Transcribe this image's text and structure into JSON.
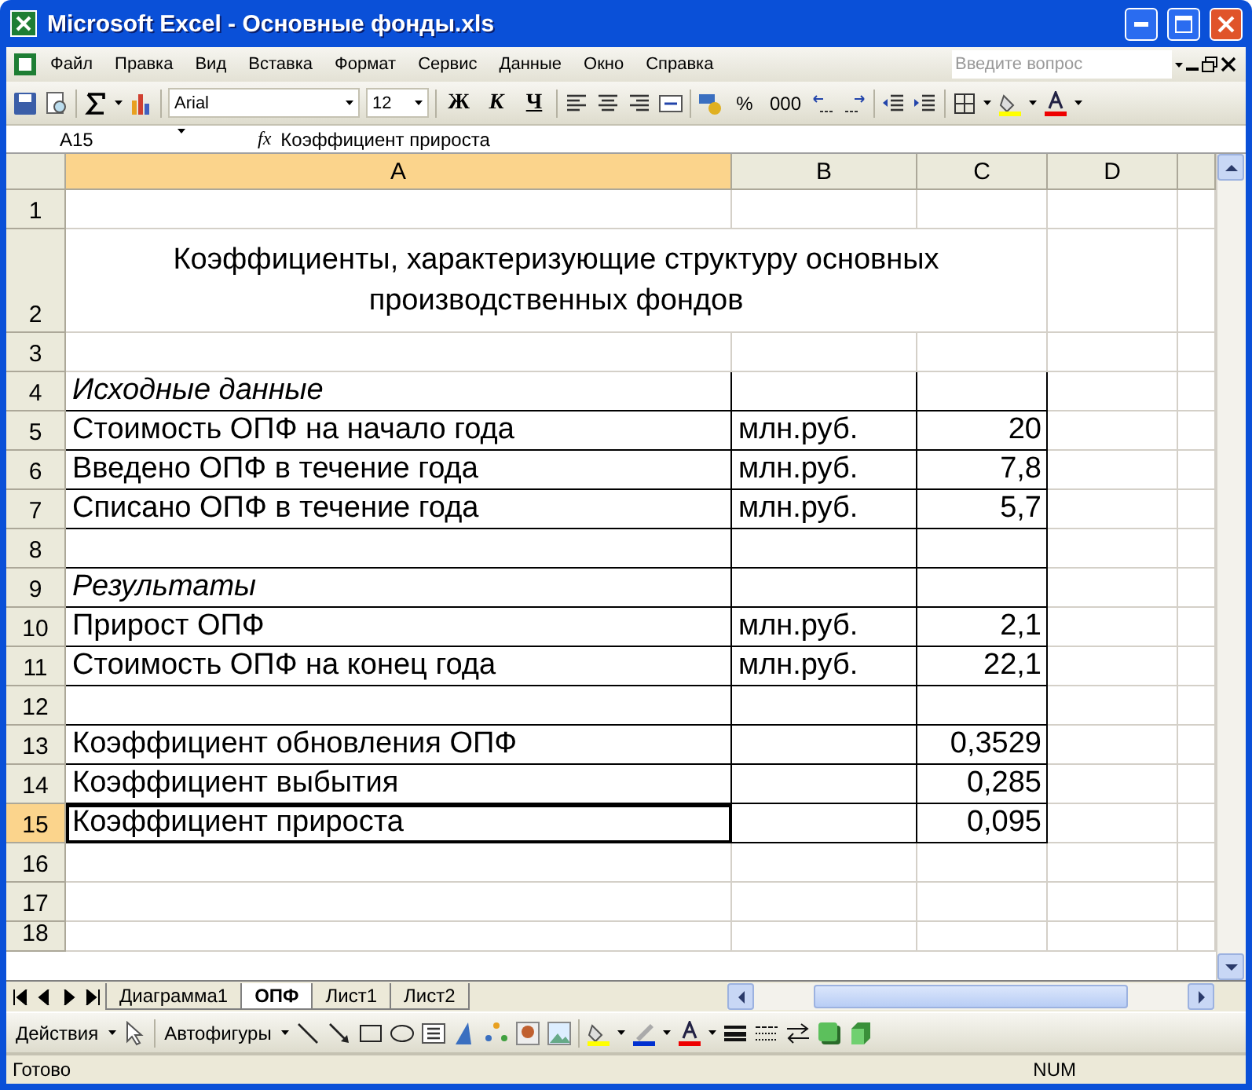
{
  "window": {
    "title": "Microsoft Excel - Основные фонды.xls"
  },
  "menu": [
    "Файл",
    "Правка",
    "Вид",
    "Вставка",
    "Формат",
    "Сервис",
    "Данные",
    "Окно",
    "Справка"
  ],
  "help_search": {
    "placeholder": "Введите вопрос"
  },
  "toolbar": [
    {
      "kind": "save"
    },
    {
      "kind": "preview"
    },
    {
      "kind": "sum"
    },
    {
      "kind": "chart"
    },
    {
      "kind": "font",
      "label": "Arial"
    },
    {
      "kind": "size",
      "label": "12"
    },
    {
      "kind": "bold",
      "label": "Ж"
    },
    {
      "kind": "italic",
      "label": "К"
    },
    {
      "kind": "underline",
      "label": "Ч"
    },
    {
      "kind": "align-left"
    },
    {
      "kind": "align-center"
    },
    {
      "kind": "align-right"
    },
    {
      "kind": "merge"
    },
    {
      "kind": "currency"
    },
    {
      "kind": "text",
      "label": "%"
    },
    {
      "kind": "text",
      "label": "000"
    },
    {
      "kind": "inc-decimal"
    },
    {
      "kind": "dec-decimal"
    },
    {
      "kind": "outdent"
    },
    {
      "kind": "indent"
    },
    {
      "kind": "borders"
    },
    {
      "kind": "fill"
    },
    {
      "kind": "font-color"
    }
  ],
  "formula_bar": {
    "cell": "A15",
    "fx": "fx",
    "content": "Коэффициент прироста"
  },
  "columns": [
    {
      "label": "A",
      "selected": true
    },
    {
      "label": "B",
      "selected": false
    },
    {
      "label": "C",
      "selected": false
    },
    {
      "label": "D",
      "selected": false
    }
  ],
  "rows": [
    {
      "num": "1",
      "kind": "blank",
      "selected": false
    },
    {
      "num": "2",
      "kind": "title",
      "a": "Коэффициенты, характеризующие структуру основных производственных фондов",
      "selected": false
    },
    {
      "num": "3",
      "kind": "blank",
      "selected": false
    },
    {
      "num": "4",
      "kind": "section",
      "a": "Исходные данные",
      "selected": false
    },
    {
      "num": "5",
      "kind": "data",
      "a": "Стоимость ОПФ на начало года",
      "b": "млн.руб.",
      "c": "20",
      "selected": false
    },
    {
      "num": "6",
      "kind": "data",
      "a": "Введено ОПФ в течение года",
      "b": "млн.руб.",
      "c": "7,8",
      "selected": false
    },
    {
      "num": "7",
      "kind": "data",
      "a": "Списано ОПФ в течение года",
      "b": "млн.руб.",
      "c": "5,7",
      "selected": false
    },
    {
      "num": "8",
      "kind": "spacer",
      "selected": false
    },
    {
      "num": "9",
      "kind": "section",
      "a": "Результаты",
      "selected": false
    },
    {
      "num": "10",
      "kind": "data",
      "a": "Прирост ОПФ",
      "b": "млн.руб.",
      "c": "2,1",
      "selected": false
    },
    {
      "num": "11",
      "kind": "data",
      "a": "Стоимость ОПФ на конец года",
      "b": "млн.руб.",
      "c": "22,1",
      "selected": false
    },
    {
      "num": "12",
      "kind": "data",
      "selected": false
    },
    {
      "num": "13",
      "kind": "data",
      "a": "Коэффициент обновления ОПФ",
      "c": "0,3529",
      "selected": false
    },
    {
      "num": "14",
      "kind": "data",
      "a": "Коэффициент выбытия",
      "c": "0,285",
      "selected": false
    },
    {
      "num": "15",
      "kind": "data",
      "a": "Коэффициент прироста",
      "c": "0,095",
      "selected": true
    },
    {
      "num": "16",
      "kind": "blank",
      "selected": false
    },
    {
      "num": "17",
      "kind": "blank",
      "selected": false
    },
    {
      "num": "18",
      "kind": "partial",
      "selected": false
    }
  ],
  "sheet_tabs": [
    {
      "label": "Диаграмма1",
      "selected": false
    },
    {
      "label": "ОПФ",
      "selected": true
    },
    {
      "label": "Лист1",
      "selected": false
    },
    {
      "label": "Лист2",
      "selected": false
    }
  ],
  "drawing_toolbar": [
    {
      "kind": "menu",
      "label": "Действия"
    },
    {
      "kind": "pointer"
    },
    {
      "kind": "menu",
      "label": "Автофигуры"
    },
    {
      "kind": "line"
    },
    {
      "kind": "arrow"
    },
    {
      "kind": "rect"
    },
    {
      "kind": "oval"
    },
    {
      "kind": "textbox"
    },
    {
      "kind": "wordart"
    },
    {
      "kind": "diagram"
    },
    {
      "kind": "clipart"
    },
    {
      "kind": "picture"
    },
    {
      "kind": "fill"
    },
    {
      "kind": "line-color"
    },
    {
      "kind": "font-color"
    },
    {
      "kind": "line-style"
    },
    {
      "kind": "dash-style"
    },
    {
      "kind": "arrow-style"
    },
    {
      "kind": "shadow"
    },
    {
      "kind": "extrusion"
    }
  ],
  "status_bar": {
    "status": "Готово",
    "num": "NUM"
  }
}
